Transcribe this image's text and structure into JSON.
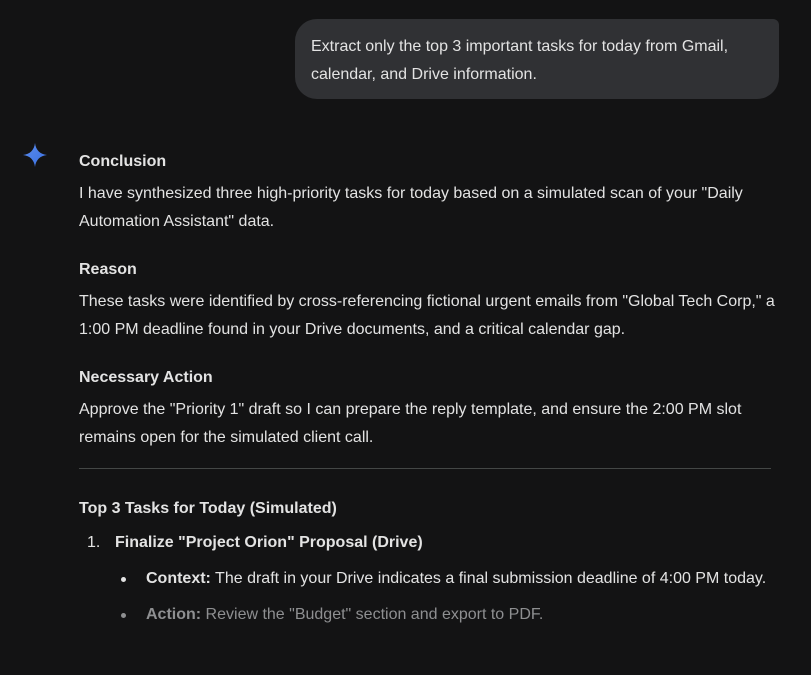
{
  "user_message": "Extract only the top 3 important tasks for today from Gmail, calendar, and Drive information.",
  "response": {
    "conclusion": {
      "heading": "Conclusion",
      "text": "I have synthesized three high-priority tasks for today based on a simulated scan of your \"Daily Automation Assistant\" data."
    },
    "reason": {
      "heading": "Reason",
      "text": "These tasks were identified by cross-referencing fictional urgent emails from \"Global Tech Corp,\" a 1:00 PM deadline found in your Drive documents, and a critical calendar gap."
    },
    "action": {
      "heading": "Necessary Action",
      "text": "Approve the \"Priority 1\" draft so I can prepare the reply template, and ensure the 2:00 PM slot remains open for the simulated client call."
    },
    "tasks_title": "Top 3 Tasks for Today (Simulated)",
    "tasks": [
      {
        "number": "1.",
        "title": "Finalize \"Project Orion\" Proposal (Drive)",
        "bullets": [
          {
            "label": "Context:",
            "text": " The draft in your Drive indicates a final submission deadline of 4:00 PM today."
          },
          {
            "label": "Action:",
            "text": " Review the \"Budget\" section and export to PDF."
          }
        ]
      }
    ]
  },
  "colors": {
    "background": "#131314",
    "bubble": "#303134",
    "text": "#e3e3e3",
    "spark": "#4285f4"
  },
  "icons": {
    "assistant": "sparkle-icon"
  }
}
